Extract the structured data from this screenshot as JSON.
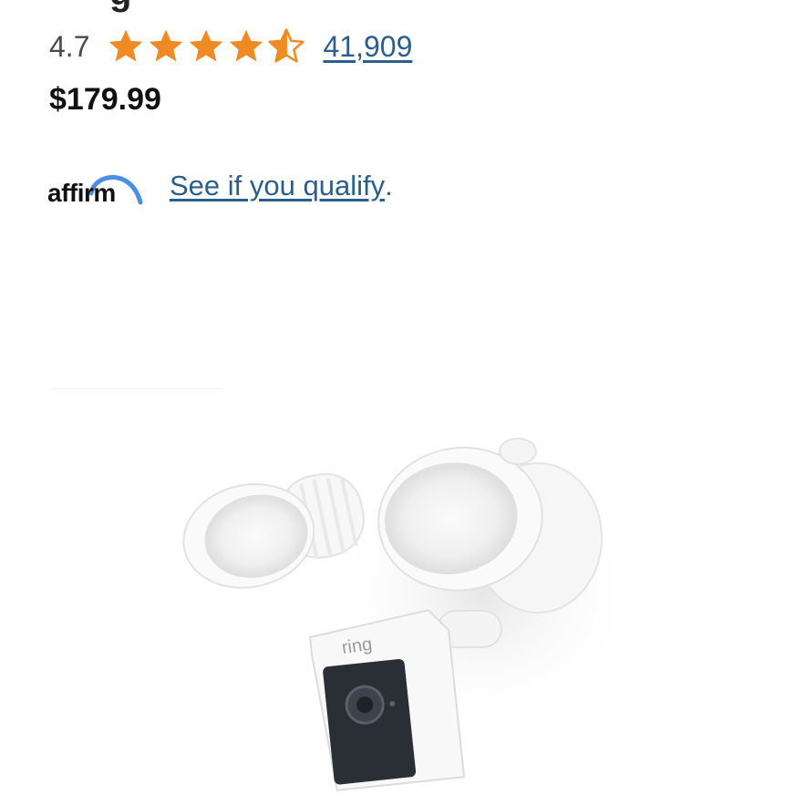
{
  "product": {
    "title_fragment": "g",
    "rating": "4.7",
    "stars": 4.7,
    "review_count": "41,909",
    "price": "$179.99"
  },
  "financing": {
    "provider": "affirm",
    "link_text": "See if you qualify",
    "link_suffix": "."
  },
  "product_image": {
    "brand_mark": "ring"
  },
  "colors": {
    "star": "#f08a24",
    "link": "#2d5d8c",
    "affirm_arc": "#4a90e2"
  }
}
